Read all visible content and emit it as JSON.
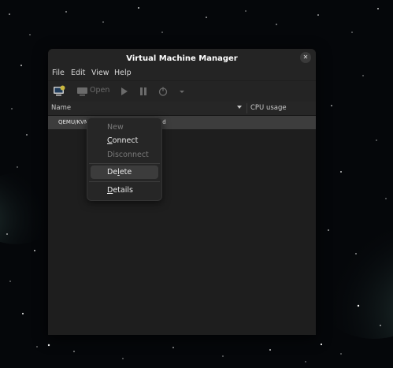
{
  "window": {
    "title": "Virtual Machine Manager"
  },
  "menubar": {
    "file": "File",
    "edit": "Edit",
    "view": "View",
    "help": "Help"
  },
  "toolbar": {
    "open_label": "Open"
  },
  "columns": {
    "name": "Name",
    "cpu": "CPU usage"
  },
  "row": {
    "label": "QEMU/KVM",
    "status_fragment": "ed"
  },
  "context_menu": {
    "new_label": "New",
    "connect": {
      "before": "",
      "mnemonic": "C",
      "after": "onnect"
    },
    "disconnect_label": "Disconnect",
    "delete": {
      "before": "De",
      "mnemonic": "l",
      "after": "ete"
    },
    "details": {
      "before": "",
      "mnemonic": "D",
      "after": "etails"
    }
  },
  "colors": {
    "window_bg": "#1e1e1e",
    "header_bg": "#242424",
    "selected_row": "#3d3d3d",
    "menu_highlight": "#3c3c3c",
    "accent_monitor": "#c9b73f"
  }
}
